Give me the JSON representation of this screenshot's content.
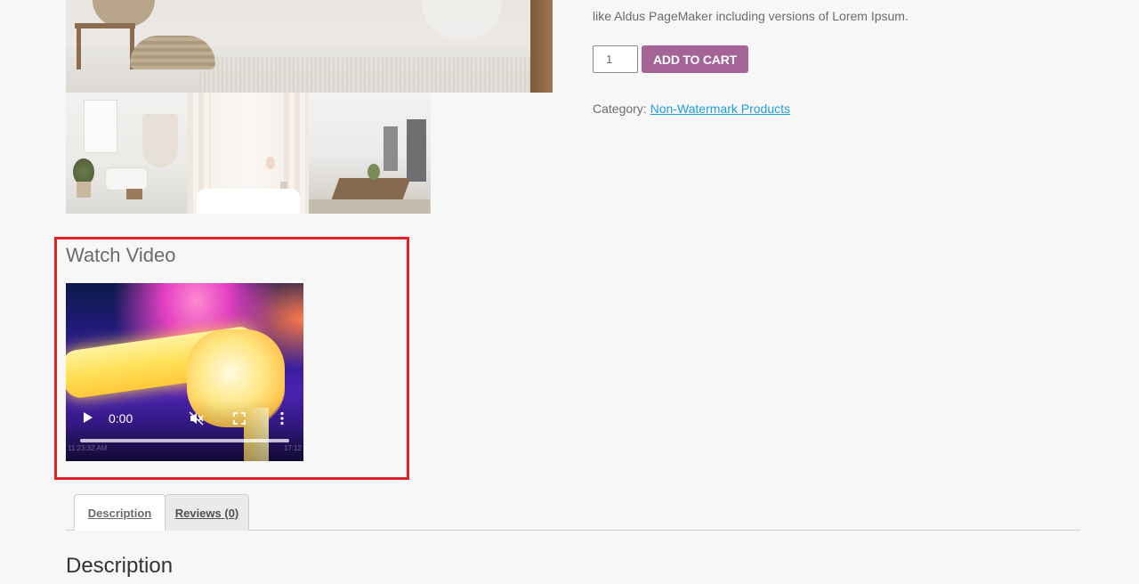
{
  "product": {
    "description_tail": "like Aldus PageMaker including versions of Lorem Ipsum.",
    "quantity": "1",
    "add_to_cart_label": "ADD TO CART",
    "category_label": "Category:",
    "category_link": "Non-Watermark Products"
  },
  "video_section": {
    "title": "Watch Video",
    "current_time": "0:00",
    "stamp_left": "11:23:32 AM",
    "stamp_right": "17:12"
  },
  "tabs": [
    {
      "label": "Description",
      "active": true
    },
    {
      "label": "Reviews (0)",
      "active": false
    }
  ],
  "content_heading": "Description",
  "colors": {
    "accent": "#a46497",
    "link": "#1e9fda",
    "highlight_border": "#e32228"
  }
}
